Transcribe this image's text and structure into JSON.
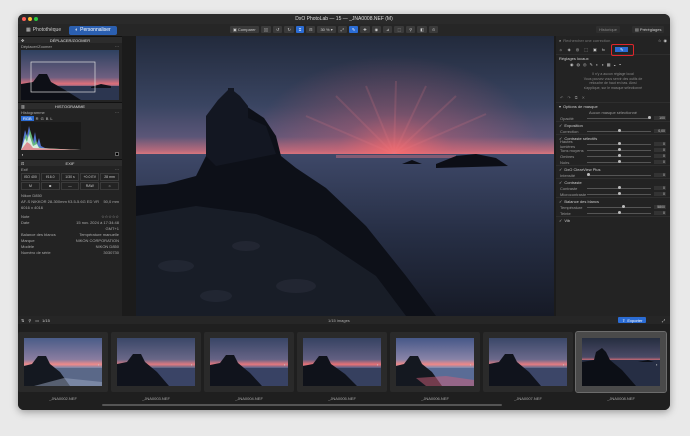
{
  "window": {
    "title": "DxO PhotoLab — 15 — _JNA0008.NEF (M)"
  },
  "tabs": [
    {
      "label": "Photothèque"
    },
    {
      "label": "Personnaliser"
    }
  ],
  "toolbar": {
    "compare_label": "Comparer",
    "zoom_label": "30 %",
    "right_button_1": "Historique",
    "right_button_2": "Préréglages"
  },
  "left": {
    "section_move": "DÉPLACER/ZOOMER",
    "move_item": "Déplacer/Zoomer",
    "section_histogram": "HISTOGRAMME",
    "histogram_item": "Histogramme",
    "histogram_modes": [
      "RGB",
      "R",
      "G",
      "B",
      "L"
    ],
    "section_exif": "EXIF",
    "exif_item": "Exif",
    "exif_grid": [
      "ISO 400",
      "f/16.0",
      "1/30 s",
      "+0.0 EV",
      "28 mm",
      "",
      "",
      "",
      "RAW",
      ""
    ],
    "lens": "AF-S NIKKOR 28-300mm f/3.5-5.6G ED VR",
    "lens_focal": "50,0 mm",
    "dims": "6016 x 4016",
    "camera": "Nikon D850",
    "fields": [
      {
        "k": "Note",
        "v": "☆☆☆☆☆"
      },
      {
        "k": "Date",
        "v": "15 nov. 2024 à 17:34:48"
      },
      {
        "k": "",
        "v": "GMT+1"
      },
      {
        "k": "Balance des blancs",
        "v": "Température manuelle"
      },
      {
        "k": "Marque",
        "v": "NIKON CORPORATION"
      },
      {
        "k": "Modèle",
        "v": "NIKON D850"
      },
      {
        "k": "Numéro de série",
        "v": "3030730"
      }
    ]
  },
  "right": {
    "search_placeholder": "Rechercher une correction",
    "local_adjust": "Réglages locaux",
    "local_msg_1": "Il n'y a aucun réglage local",
    "local_msg_2": "Vous pouvez vous servir des outils de",
    "local_msg_3": "retouche de haut en bas. Ainsi",
    "local_msg_4": "s'applique, sur le masque sélectionné",
    "mask_options": "Options de masque",
    "no_mask": "Aucun masque sélectionné",
    "rows": [
      {
        "label": "Opacité",
        "value": "100"
      },
      {
        "section": "Exposition"
      },
      {
        "label": "Correction",
        "value": "0,00"
      },
      {
        "section": "Contraste sélectifs"
      },
      {
        "label": "Hautes lumières",
        "value": "0"
      },
      {
        "label": "Tons moyens",
        "value": "0"
      },
      {
        "label": "Ombres",
        "value": "0"
      },
      {
        "label": "Noirs",
        "value": "0"
      },
      {
        "section": "DxO ClearView Plus"
      },
      {
        "label": "Intensité",
        "value": "0"
      },
      {
        "section": "Contraste"
      },
      {
        "label": "Contraste",
        "value": "0"
      },
      {
        "label": "Microcontraste",
        "value": "0"
      },
      {
        "section": "Balance des blancs"
      },
      {
        "label": "Température",
        "value": "5800"
      },
      {
        "label": "Teinte",
        "value": "0"
      },
      {
        "section": "Vib"
      }
    ]
  },
  "strip": {
    "count": "1/15",
    "images_label": "1/15 images",
    "export_label": "Exporter"
  },
  "thumbnails": [
    {
      "name": "_JNA0002.NEF"
    },
    {
      "name": "_JNA0003.NEF"
    },
    {
      "name": "_JNA0004.NEF"
    },
    {
      "name": "_JNA0005.NEF"
    },
    {
      "name": "_JNA0006.NEF"
    },
    {
      "name": "_JNA0007.NEF"
    },
    {
      "name": "_JNA0008.NEF"
    }
  ],
  "colors": {
    "accent": "#2b6cd4",
    "annotation": "#e0262b"
  }
}
